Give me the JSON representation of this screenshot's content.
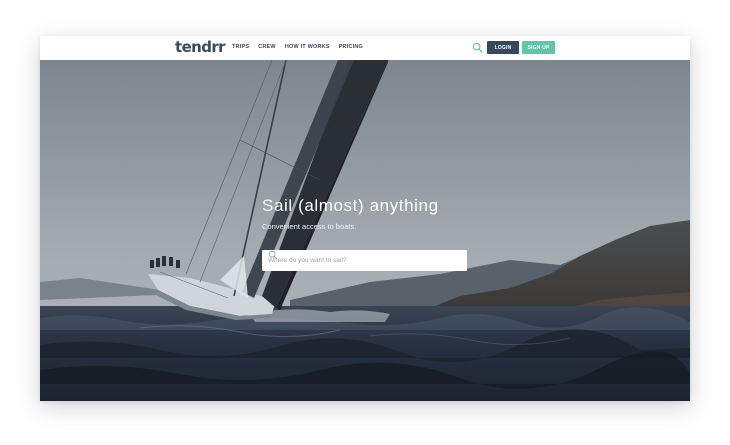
{
  "brand": {
    "logo_text": "tendrr"
  },
  "nav": {
    "links": [
      "TRIPS",
      "CREW",
      "HOW IT WORKS",
      "PRICING"
    ],
    "login_label": "LOGIN",
    "signup_label": "SIGN UP"
  },
  "hero": {
    "headline": "Sail (almost) anything",
    "subheadline": "Convenient access to boats.",
    "search_placeholder": "Where do you want to sail?"
  },
  "icons": {
    "search": "search-icon",
    "hero_search": "search-icon"
  },
  "colors": {
    "brand_dark": "#34495e",
    "accent_green": "#5fc6a7",
    "sea": "#2a3340",
    "sky": "#8a939b"
  }
}
